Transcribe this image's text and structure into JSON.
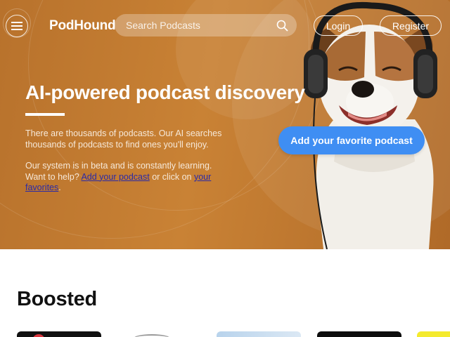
{
  "nav": {
    "brand": "PodHound",
    "search_placeholder": "Search Podcasts",
    "login_label": "Login",
    "register_label": "Register"
  },
  "hero": {
    "title": "AI-powered podcast discovery",
    "paragraph1": "There are thousands of podcasts. Our AI searches thousands of podcasts to find ones you'll enjoy.",
    "paragraph2_start": "Our system is in beta and is constantly learning. Want to help? ",
    "add_link": "Add your podcast",
    "paragraph2_mid": " or click on ",
    "favorites_link": "your favorites",
    "paragraph2_end": ".",
    "cta_label": "Add your favorite podcast"
  },
  "boosted": {
    "title": "Boosted"
  },
  "colors": {
    "hero_background": "#c07a30",
    "cta": "#3f8ef3",
    "link": "#2a2aa8"
  },
  "icons": [
    "menu-icon",
    "search-icon"
  ]
}
